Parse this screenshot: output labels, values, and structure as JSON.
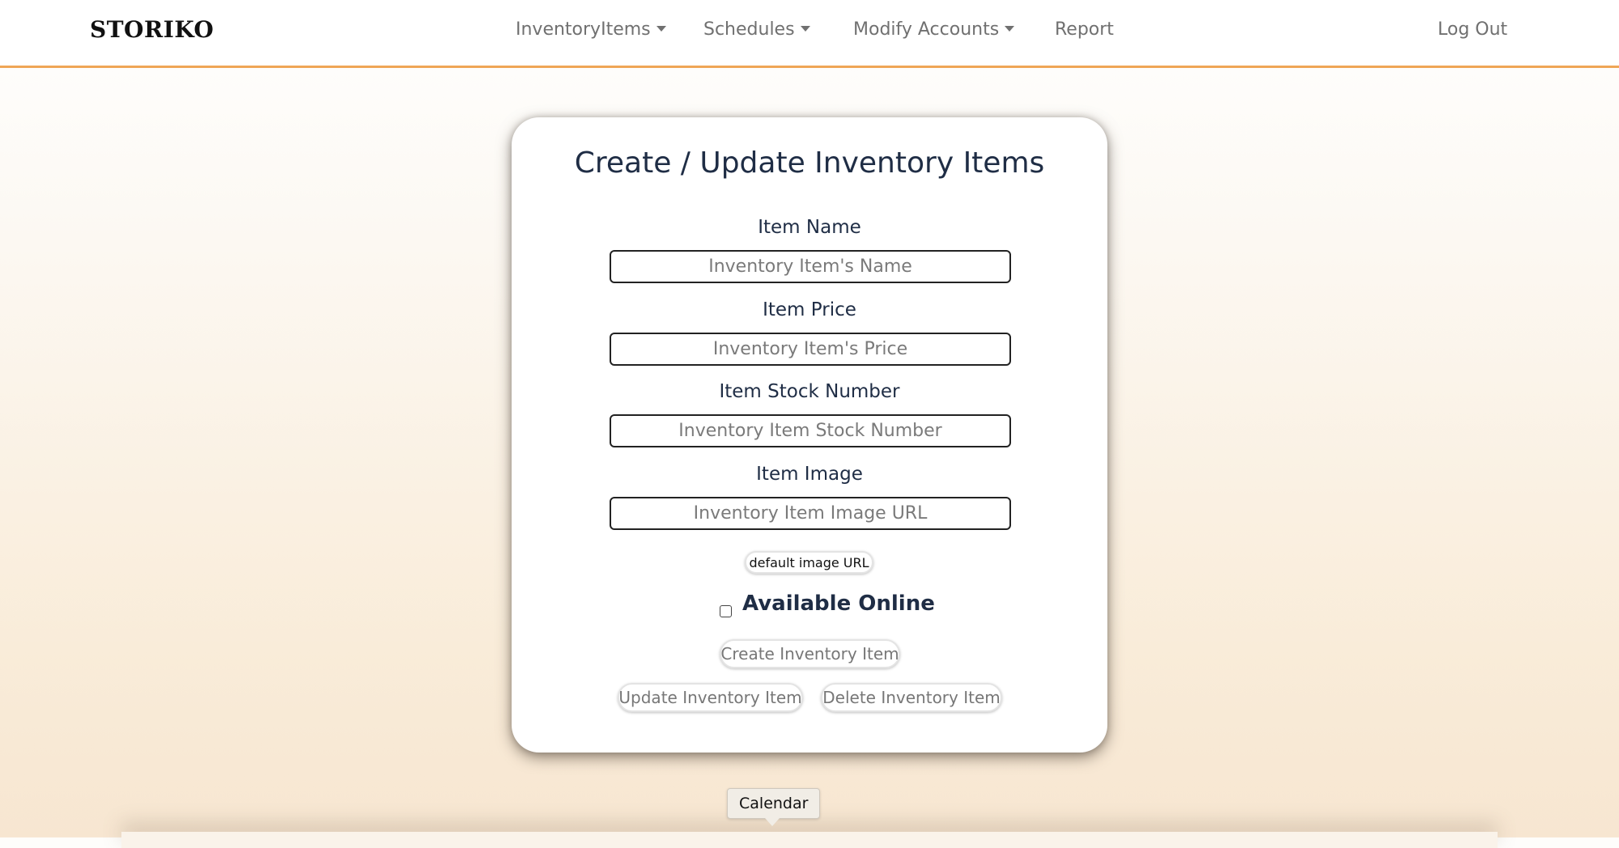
{
  "navbar": {
    "brand": "STORIKO",
    "items": [
      {
        "label": "InventoryItems",
        "has_caret": true
      },
      {
        "label": "Schedules",
        "has_caret": true
      },
      {
        "label": "Modify Accounts",
        "has_caret": true
      },
      {
        "label": "Report",
        "has_caret": false
      }
    ],
    "logout": "Log Out",
    "accent_color": "#efa656"
  },
  "form": {
    "title": "Create / Update Inventory Items",
    "fields": [
      {
        "label": "Item Name",
        "placeholder": "Inventory Item's Name",
        "value": ""
      },
      {
        "label": "Item Price",
        "placeholder": "Inventory Item's Price",
        "value": ""
      },
      {
        "label": "Item Stock Number",
        "placeholder": "Inventory Item Stock Number",
        "value": ""
      },
      {
        "label": "Item Image",
        "placeholder": "Inventory Item Image URL",
        "value": ""
      }
    ],
    "default_image_button": "default image URL",
    "available_online": {
      "label": "Available Online",
      "checked": false
    },
    "buttons": {
      "create": "Create Inventory Item",
      "update": "Update Inventory Item",
      "delete": "Delete Inventory Item"
    }
  },
  "tooltip": {
    "text": "Calendar"
  }
}
